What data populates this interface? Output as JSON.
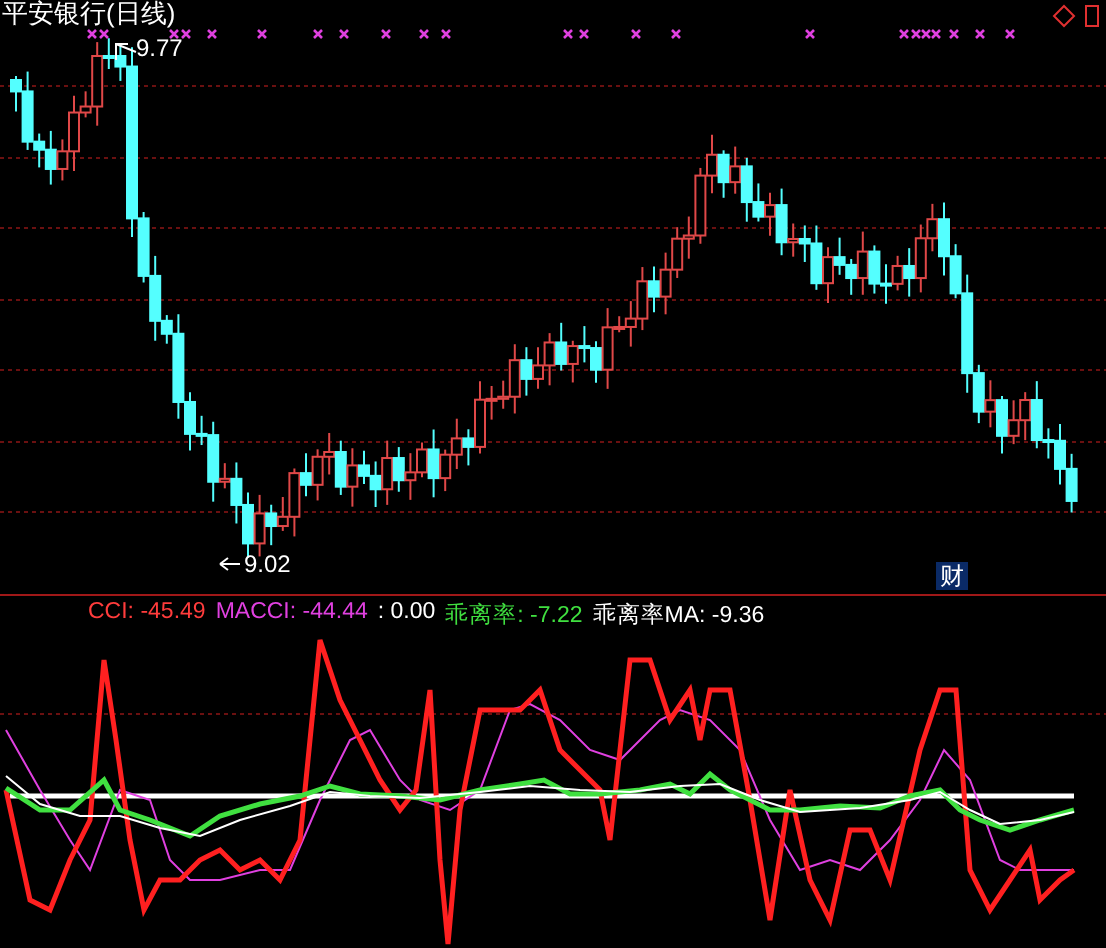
{
  "chart_title": "平安银行(日线)",
  "high_marker": "9.77",
  "low_marker": "9.02",
  "badge": "财",
  "indicator_legend": [
    {
      "text": "CCI: -45.49",
      "color": "#ff3c3c"
    },
    {
      "text": "MACCI: -44.44",
      "color": "#e040e0"
    },
    {
      "text": ": 0.00",
      "color": "#ffffff"
    },
    {
      "text": "乖离率: -7.22",
      "color": "#40e040"
    },
    {
      "text": "乖离率MA: -9.36",
      "color": "#ffffff"
    }
  ]
}
